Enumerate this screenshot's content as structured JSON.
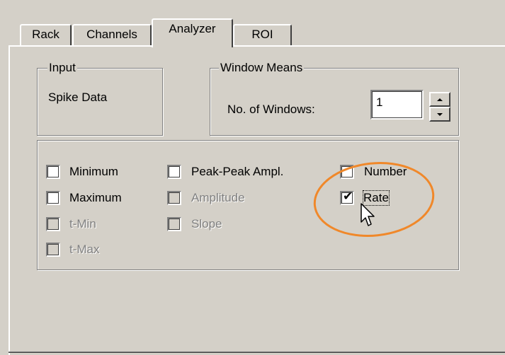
{
  "tabs": [
    {
      "label": "Rack"
    },
    {
      "label": "Channels"
    },
    {
      "label": "Analyzer"
    },
    {
      "label": "ROI"
    }
  ],
  "active_tab": "Analyzer",
  "input_group": {
    "legend": "Input",
    "value": "Spike Data"
  },
  "window_means": {
    "legend": "Window Means",
    "windows_label": "No. of Windows:",
    "windows_value": "1"
  },
  "options": {
    "minimum": {
      "label": "Minimum",
      "checked": false,
      "enabled": true
    },
    "maximum": {
      "label": "Maximum",
      "checked": false,
      "enabled": true
    },
    "tmin": {
      "label": "t-Min",
      "checked": false,
      "enabled": false
    },
    "tmax": {
      "label": "t-Max",
      "checked": false,
      "enabled": false
    },
    "peakpeak": {
      "label": "Peak-Peak Ampl.",
      "checked": false,
      "enabled": true
    },
    "amplitude": {
      "label": "Amplitude",
      "checked": false,
      "enabled": false
    },
    "slope": {
      "label": "Slope",
      "checked": false,
      "enabled": false
    },
    "number": {
      "label": "Number",
      "checked": false,
      "enabled": true
    },
    "rate": {
      "label": "Rate",
      "checked": true,
      "enabled": true
    }
  },
  "check_glyph": "✔",
  "highlight_color": "#f0882a"
}
